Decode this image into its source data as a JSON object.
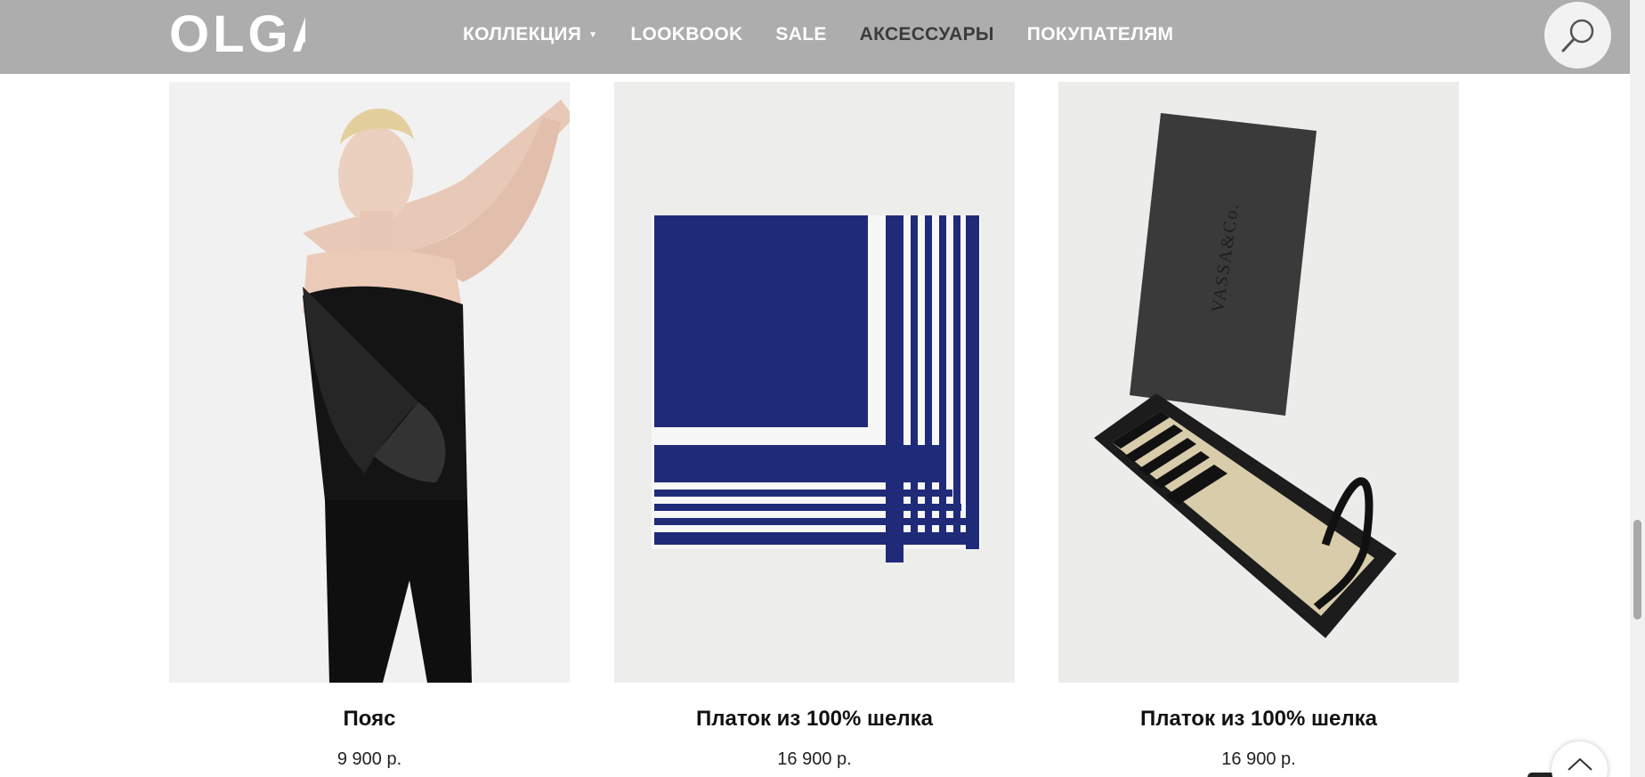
{
  "header": {
    "logo_text": "OLGA",
    "nav": [
      {
        "label": "КОЛЛЕКЦИЯ",
        "has_dropdown": true
      },
      {
        "label": "LOOKBOOK"
      },
      {
        "label": "SALE"
      },
      {
        "label": "АКСЕССУАРЫ"
      },
      {
        "label": "ПОКУПАТЕЛЯМ"
      }
    ]
  },
  "products": [
    {
      "name": "Пояс",
      "price": "9 900 р."
    },
    {
      "name": "Платок из 100% шелка",
      "price": "16 900 р."
    },
    {
      "name": "Платок из 100% шелка",
      "price": "16 900 р."
    }
  ],
  "box_brand_text": "VASSA&Co.",
  "colors": {
    "header_bg": "#adadad",
    "nav_text": "#ffffff",
    "nav_active": "#3b3b3b",
    "scarf_navy": "#1f2a78"
  }
}
